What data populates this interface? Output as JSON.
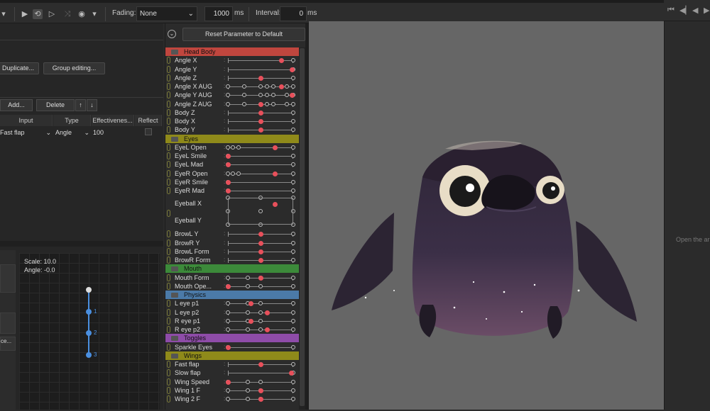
{
  "toolbar": {
    "fading_label": "Fading:",
    "fading_value": "None",
    "duration_value": "1000",
    "duration_unit": "ms",
    "interval_label": "Interval:",
    "interval_value": "0",
    "interval_unit": "ms"
  },
  "right_panel": {
    "hint": "Open the ar"
  },
  "left_panel": {
    "duplicate_label": "Duplicate...",
    "group_edit_label": "Group editing...",
    "add_label": "Add...",
    "delete_label": "Delete",
    "up_label": "↑",
    "down_label": "↓",
    "columns": [
      "Input",
      "Type",
      "Effectivenes...",
      "Reflect"
    ],
    "row": {
      "input": "Fast flap",
      "type": "Angle",
      "effectiveness": "100"
    },
    "side_label": "ce..."
  },
  "graph": {
    "scale_text": "Scale: 10.0",
    "angle_text": "Angle: -0.0",
    "points": [
      "1",
      "2",
      "3"
    ]
  },
  "params": {
    "reset_label": "Reset Parameter to Default",
    "groups": [
      {
        "name": "Head Body",
        "color": "#c0463e",
        "items": [
          "Angle X",
          "Angle Y",
          "Angle Z",
          "Angle X AUG",
          "Angle Y AUG",
          "Angle Z AUG",
          "Body Z",
          "Body X",
          "Body Y"
        ]
      },
      {
        "name": "Eyes",
        "color": "#8f8a1a",
        "items": [
          "EyeL Open",
          "EyeL Smile",
          "EyeL Mad",
          "EyeR Open",
          "EyeR Smile",
          "EyeR Mad",
          "Eyeball X",
          "Eyeball Y",
          "BrowL Y",
          "BrowR Y",
          "BrowL Form",
          "BrowR Form"
        ]
      },
      {
        "name": "Mouth",
        "color": "#3c8a3a",
        "items": [
          "Mouth Form",
          "Mouth Ope..."
        ]
      },
      {
        "name": "Physics",
        "color": "#4b7aa8",
        "items": [
          "L eye p1",
          "L eye p2",
          "R eye p1",
          "R eye p2"
        ]
      },
      {
        "name": "Toggles",
        "color": "#8e4ca8",
        "items": [
          "Sparkle Eyes"
        ]
      },
      {
        "name": "Wings",
        "color": "#8f8a1a",
        "items": [
          "Fast flap",
          "Slow flap",
          "Wing Speed",
          "Wing 1 F",
          "Wing 2 F"
        ]
      }
    ]
  },
  "colors": {
    "accent_knob": "#e8505b",
    "canvas_bg": "#666666"
  }
}
